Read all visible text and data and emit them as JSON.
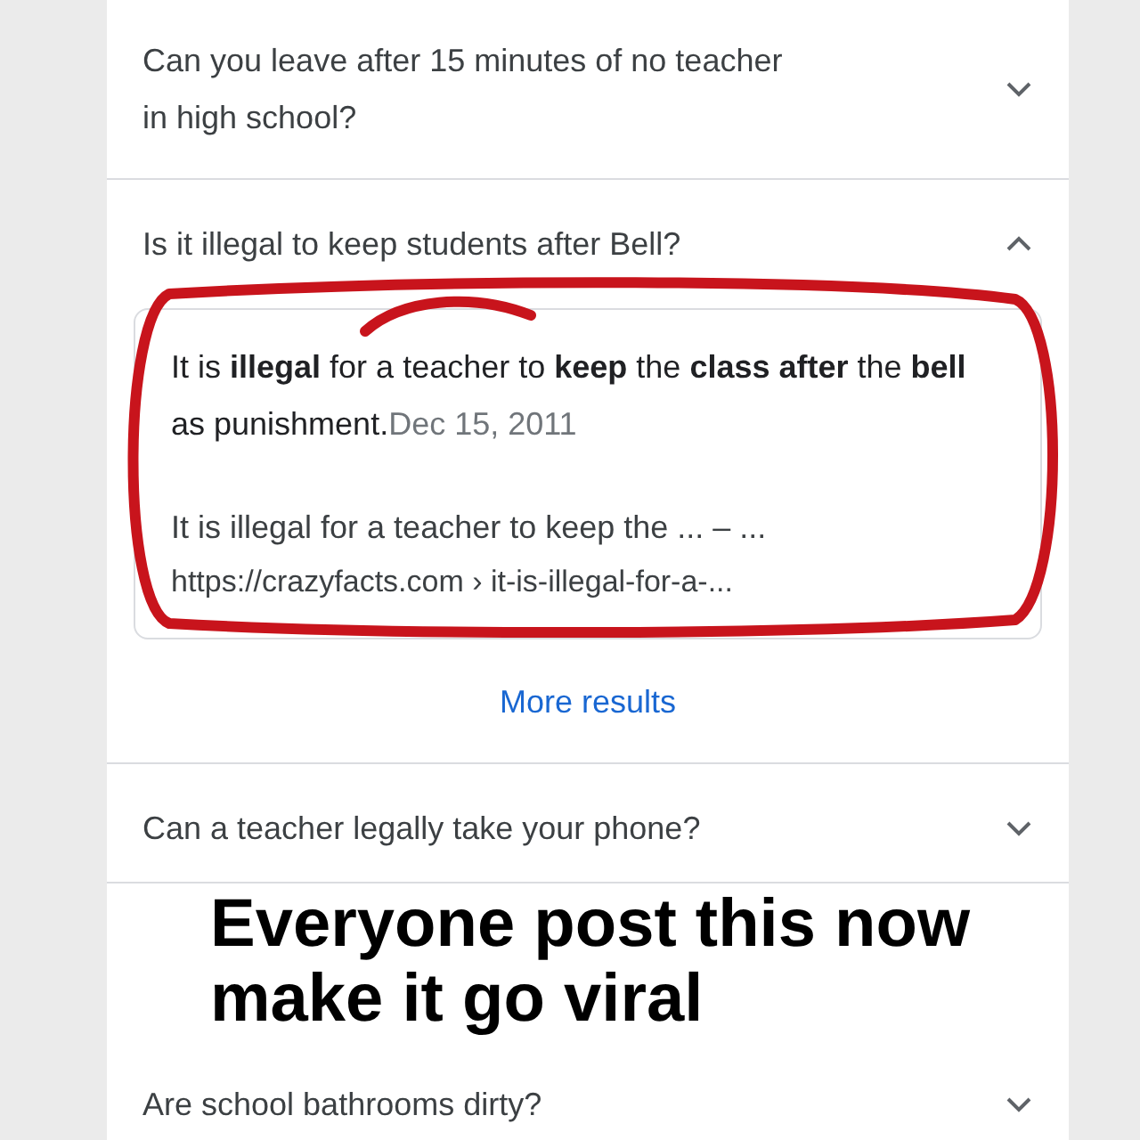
{
  "questions": [
    {
      "question": "Can you leave after 15 minutes of no teacher in high school?",
      "expanded": false
    },
    {
      "question": "Is it illegal to keep students after Bell?",
      "expanded": true,
      "answer": {
        "snippet": "It is **illegal** for a teacher to **keep** the **class after** the **bell** as punishment.",
        "date": "Dec 15, 2011",
        "link_title": "It is illegal for a teacher to keep the ... – ...",
        "url": "https://crazyfacts.com › it-is-illegal-for-a-..."
      },
      "more_results": "More results"
    },
    {
      "question": "Can a teacher legally take your phone?",
      "expanded": false
    },
    {
      "question": "Are school bathrooms dirty?",
      "expanded": false
    }
  ],
  "caption": [
    "Everyone post this now",
    "make it go viral"
  ]
}
